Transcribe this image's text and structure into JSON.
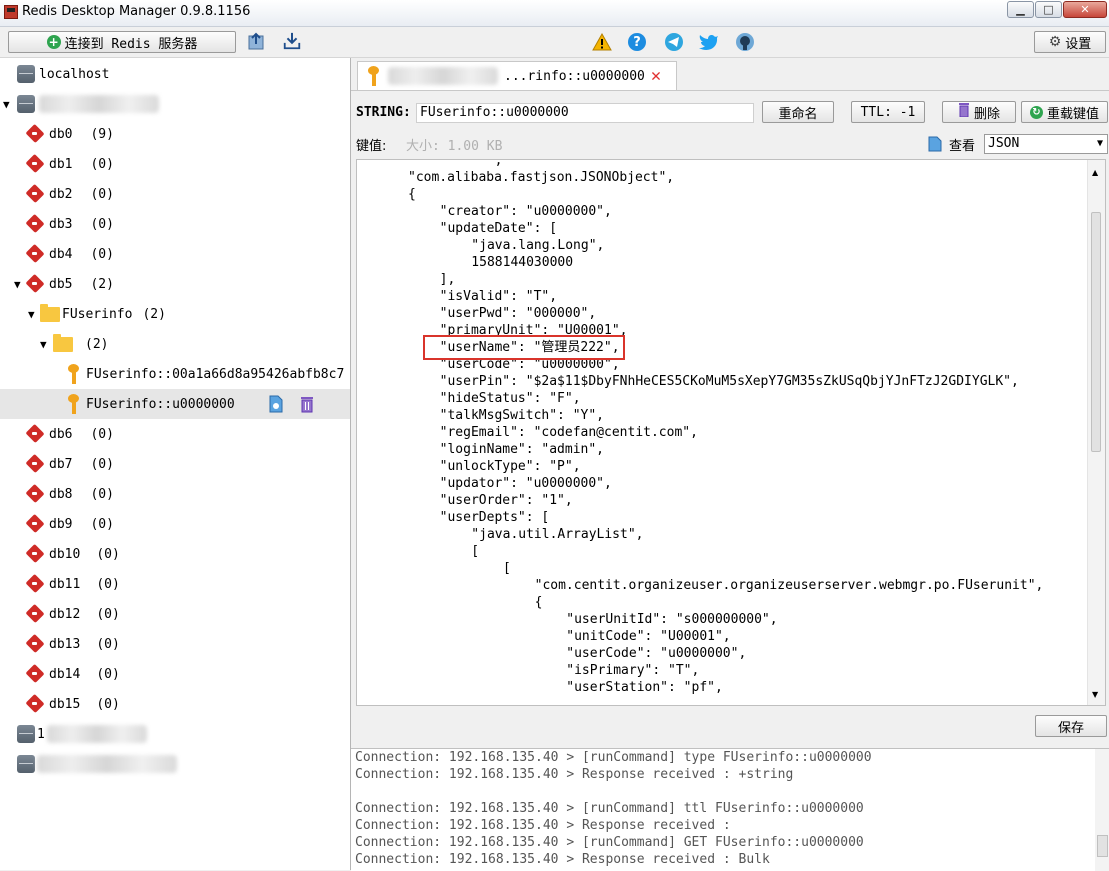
{
  "window": {
    "title": "Redis Desktop Manager 0.9.8.1156"
  },
  "toolbar": {
    "connect_label": "连接到 Redis 服务器",
    "settings_label": "设置"
  },
  "tree": {
    "localhost": "localhost",
    "databases": [
      {
        "name": "db0",
        "count": "(9)"
      },
      {
        "name": "db1",
        "count": "(0)"
      },
      {
        "name": "db2",
        "count": "(0)"
      },
      {
        "name": "db3",
        "count": "(0)"
      },
      {
        "name": "db4",
        "count": "(0)"
      },
      {
        "name": "db5",
        "count": "(2)"
      }
    ],
    "folder": {
      "name": "FUserinfo",
      "count": "(2)"
    },
    "subfolder": {
      "count": "(2)"
    },
    "keys": [
      "FUserinfo::00a1a66d8a95426abfb8c7",
      "FUserinfo::u0000000"
    ],
    "databases_after": [
      {
        "name": "db6",
        "count": "(0)"
      },
      {
        "name": "db7",
        "count": "(0)"
      },
      {
        "name": "db8",
        "count": "(0)"
      },
      {
        "name": "db9",
        "count": "(0)"
      },
      {
        "name": "db10",
        "count": "(0)"
      },
      {
        "name": "db11",
        "count": "(0)"
      },
      {
        "name": "db12",
        "count": "(0)"
      },
      {
        "name": "db13",
        "count": "(0)"
      },
      {
        "name": "db14",
        "count": "(0)"
      },
      {
        "name": "db15",
        "count": "(0)"
      }
    ],
    "bottom_server_prefix": "1"
  },
  "tab": {
    "label": "...rinfo::u0000000"
  },
  "key_header": {
    "type_label": "STRING:",
    "key_name": "FUserinfo::u0000000",
    "rename_label": "重命名",
    "ttl_label": "TTL: -1",
    "delete_label": "删除",
    "reload_label": "重载键值"
  },
  "value_bar": {
    "value_label": "键值:",
    "size_label": "大小: 1.00 KB",
    "view_label": "查看",
    "format": "JSON"
  },
  "editor_lines": [
    "  ,",
    "\"com.alibaba.fastjson.JSONObject\",",
    "{",
    "  \"creator\": \"u0000000\",",
    "  \"updateDate\": [",
    "    \"java.lang.Long\",",
    "    1588144030000",
    "  ],",
    "  \"isValid\": \"T\",",
    "  \"userPwd\": \"000000\",",
    "  \"primaryUnit\": \"U00001\",",
    "  \"userName\": \"管理员222\",",
    "  \"userCode\": \"u0000000\",",
    "  \"userPin\": \"$2a$11$DbyFNhHeCES5CKoMuM5sXepY7GM35sZkUSqQbjYJnFTzJ2GDIYGLK\",",
    "  \"hideStatus\": \"F\",",
    "  \"talkMsgSwitch\": \"Y\",",
    "  \"regEmail\": \"codefan@centit.com\",",
    "  \"loginName\": \"admin\",",
    "  \"unlockType\": \"P\",",
    "  \"updator\": \"u0000000\",",
    "  \"userOrder\": \"1\",",
    "  \"userDepts\": [",
    "    \"java.util.ArrayList\",",
    "    [",
    "      [",
    "        \"com.centit.organizeuser.organizeuserserver.webmgr.po.FUserunit\",",
    "        {",
    "          \"userUnitId\": \"s000000000\",",
    "          \"unitCode\": \"U00001\",",
    "          \"userCode\": \"u0000000\",",
    "          \"isPrimary\": \"T\",",
    "          \"userStation\": \"pf\","
  ],
  "save_label": "保存",
  "console_lines": [
    "Connection: 192.168.135.40 > [runCommand] type FUserinfo::u0000000",
    "Connection: 192.168.135.40 > Response received : +string",
    "",
    "Connection: 192.168.135.40 > [runCommand] ttl FUserinfo::u0000000",
    "Connection: 192.168.135.40 > Response received :",
    "Connection: 192.168.135.40 > [runCommand] GET FUserinfo::u0000000",
    "Connection: 192.168.135.40 > Response received : Bulk"
  ]
}
